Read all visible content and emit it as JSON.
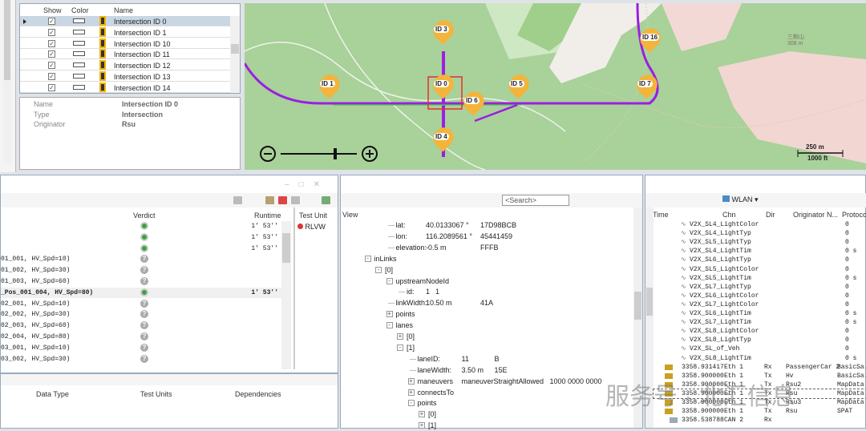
{
  "intersection_table": {
    "headers": {
      "show": "Show",
      "color": "Color",
      "name": "Name"
    },
    "rows": [
      "Intersection ID 0",
      "Intersection ID 1",
      "Intersection ID 10",
      "Intersection ID 11",
      "Intersection ID 12",
      "Intersection ID 13",
      "Intersection ID 14"
    ]
  },
  "properties": [
    {
      "label": "Name",
      "value": "Intersection ID 0"
    },
    {
      "label": "Type",
      "value": "Intersection"
    },
    {
      "label": "Originator",
      "value": "Rsu"
    }
  ],
  "map": {
    "pins": [
      "ID 3",
      "ID 1",
      "ID 0",
      "ID 5",
      "ID 6",
      "ID 4",
      "ID 16",
      "ID 7"
    ],
    "scale_m": "250 m",
    "scale_ft": "1000 ft",
    "peak_label": "三耥山",
    "peak_elev": "308 m",
    "route_color": "#9b1fe0"
  },
  "test_panel": {
    "headers": {
      "verdict": "Verdict",
      "runtime": "Runtime",
      "test_unit": "Test Unit"
    },
    "test_unit": "RLVW",
    "rows": [
      {
        "name": "",
        "verdict": "pass",
        "runtime": "1′ 53′′"
      },
      {
        "name": "",
        "verdict": "pass",
        "runtime": "1′ 53′′"
      },
      {
        "name": "",
        "verdict": "pass",
        "runtime": "1′ 53′′"
      },
      {
        "name": "01_001, HV_Spd=10)",
        "verdict": "unknown",
        "runtime": ""
      },
      {
        "name": "01_002, HV_Spd=30)",
        "verdict": "unknown",
        "runtime": ""
      },
      {
        "name": "01_003, HV_Spd=60)",
        "verdict": "unknown",
        "runtime": ""
      },
      {
        "name": "_Pos_001_004, HV_Spd=80)",
        "verdict": "pass",
        "runtime": "1′ 53′′",
        "bold": true
      },
      {
        "name": "02_001, HV_Spd=10)",
        "verdict": "unknown",
        "runtime": ""
      },
      {
        "name": "02_002, HV_Spd=30)",
        "verdict": "unknown",
        "runtime": ""
      },
      {
        "name": "02_003, HV_Spd=60)",
        "verdict": "unknown",
        "runtime": ""
      },
      {
        "name": "02_004, HV_Spd=80)",
        "verdict": "unknown",
        "runtime": ""
      },
      {
        "name": "03_001, HV_Spd=10)",
        "verdict": "unknown",
        "runtime": ""
      },
      {
        "name": "03_002, HV_Spd=30)",
        "verdict": "unknown",
        "runtime": ""
      }
    ],
    "lower_headers": {
      "data_type": "Data Type",
      "test_units": "Test Units",
      "dependencies": "Dependencies"
    }
  },
  "detail_view": {
    "search_placeholder": "<Search>",
    "view_label": "View",
    "tree": [
      {
        "d": 3,
        "k": "lat:",
        "v": "40.0133067 °",
        "h": "17D98BCB",
        "e": ""
      },
      {
        "d": 3,
        "k": "lon:",
        "v": "116.2089561 °",
        "h": "45441459",
        "e": ""
      },
      {
        "d": 3,
        "k": "elevation:",
        "v": "-0.5 m",
        "h": "FFFB",
        "e": ""
      },
      {
        "d": 1,
        "k": "inLinks",
        "v": "",
        "h": "",
        "e": "-"
      },
      {
        "d": 2,
        "k": "[0]",
        "v": "",
        "h": "",
        "e": "-"
      },
      {
        "d": 3,
        "k": "upstreamNodeId",
        "v": "",
        "h": "",
        "e": "-"
      },
      {
        "d": 4,
        "k": "id:",
        "v": "1",
        "h": "1",
        "e": ""
      },
      {
        "d": 3,
        "k": "linkWidth:",
        "v": "10.50 m",
        "h": "41A",
        "e": ""
      },
      {
        "d": 3,
        "k": "points",
        "v": "",
        "h": "",
        "e": "+"
      },
      {
        "d": 3,
        "k": "lanes",
        "v": "",
        "h": "",
        "e": "-"
      },
      {
        "d": 4,
        "k": "[0]",
        "v": "",
        "h": "",
        "e": "+"
      },
      {
        "d": 4,
        "k": "[1]",
        "v": "",
        "h": "",
        "e": "-"
      },
      {
        "d": 5,
        "k": "laneID:",
        "v": "11",
        "h": "B",
        "e": ""
      },
      {
        "d": 5,
        "k": "laneWidth:",
        "v": "3.50 m",
        "h": "15E",
        "e": ""
      },
      {
        "d": 5,
        "k": "maneuvers",
        "v": "maneuverStraightAllowed",
        "h": "1000 0000 0000",
        "e": "+"
      },
      {
        "d": 5,
        "k": "connectsTo",
        "v": "",
        "h": "",
        "e": "+"
      },
      {
        "d": 5,
        "k": "points",
        "v": "",
        "h": "",
        "e": "-"
      },
      {
        "d": 6,
        "k": "[0]",
        "v": "",
        "h": "",
        "e": "+"
      },
      {
        "d": 6,
        "k": "[1]",
        "v": "",
        "h": "",
        "e": "+"
      }
    ]
  },
  "trace": {
    "wlan_label": "WLAN",
    "headers": {
      "time": "Time",
      "chn": "Chn",
      "dir": "Dir",
      "originator": "Originator N...",
      "protocol": "Protoco"
    },
    "signals": [
      {
        "name": "V2X_SL4_LightColor",
        "val": "0"
      },
      {
        "name": "V2X_SL4_LightTyp",
        "val": "0"
      },
      {
        "name": "V2X_SL5_LightTyp",
        "val": "0"
      },
      {
        "name": "V2X_SL4_LightTim",
        "val": "0 s"
      },
      {
        "name": "V2X_SL6_LightTyp",
        "val": "0"
      },
      {
        "name": "V2X_SL5_LightColor",
        "val": "0"
      },
      {
        "name": "V2X_SL5_LightTim",
        "val": "0 s"
      },
      {
        "name": "V2X_SL7_LightTyp",
        "val": "0"
      },
      {
        "name": "V2X_SL6_LightColor",
        "val": "0"
      },
      {
        "name": "V2X_SL7_LightColor",
        "val": "0"
      },
      {
        "name": "V2X_SL6_LightTim",
        "val": "0 s"
      },
      {
        "name": "V2X_SL7_LightTim",
        "val": "0 s"
      },
      {
        "name": "V2X_SL8_LightColor",
        "val": "0"
      },
      {
        "name": "V2X_SL8_LightTyp",
        "val": "0"
      },
      {
        "name": "V2X_SL_of_Veh",
        "val": "0"
      },
      {
        "name": "V2X_SL8_LightTim",
        "val": "0 s"
      }
    ],
    "messages": [
      {
        "time": "3358.931417",
        "chn": "Eth 1",
        "dir": "Rx",
        "orig": "PassengerCar 2",
        "proto": "BasicSa..."
      },
      {
        "time": "3358.900000",
        "chn": "Eth 1",
        "dir": "Tx",
        "orig": "Hv",
        "proto": "BasicSa..."
      },
      {
        "time": "3358.900000",
        "chn": "Eth 1",
        "dir": "Tx",
        "orig": "Rsu2",
        "proto": "MapData"
      },
      {
        "time": "3358.900000",
        "chn": "Eth 1",
        "dir": "Tx",
        "orig": "Rsu",
        "proto": "MapData",
        "sel": true
      },
      {
        "time": "3358.900000",
        "chn": "Eth 1",
        "dir": "Tx",
        "orig": "Rsu3",
        "proto": "MapData"
      },
      {
        "time": "3358.900000",
        "chn": "Eth 1",
        "dir": "Tx",
        "orig": "Rsu",
        "proto": "SPAT"
      },
      {
        "time": "3358.538788",
        "chn": "CAN 2",
        "dir": "Rx",
        "orig": "",
        "proto": ""
      }
    ]
  },
  "watermark": "服务号 · 北汇信息"
}
